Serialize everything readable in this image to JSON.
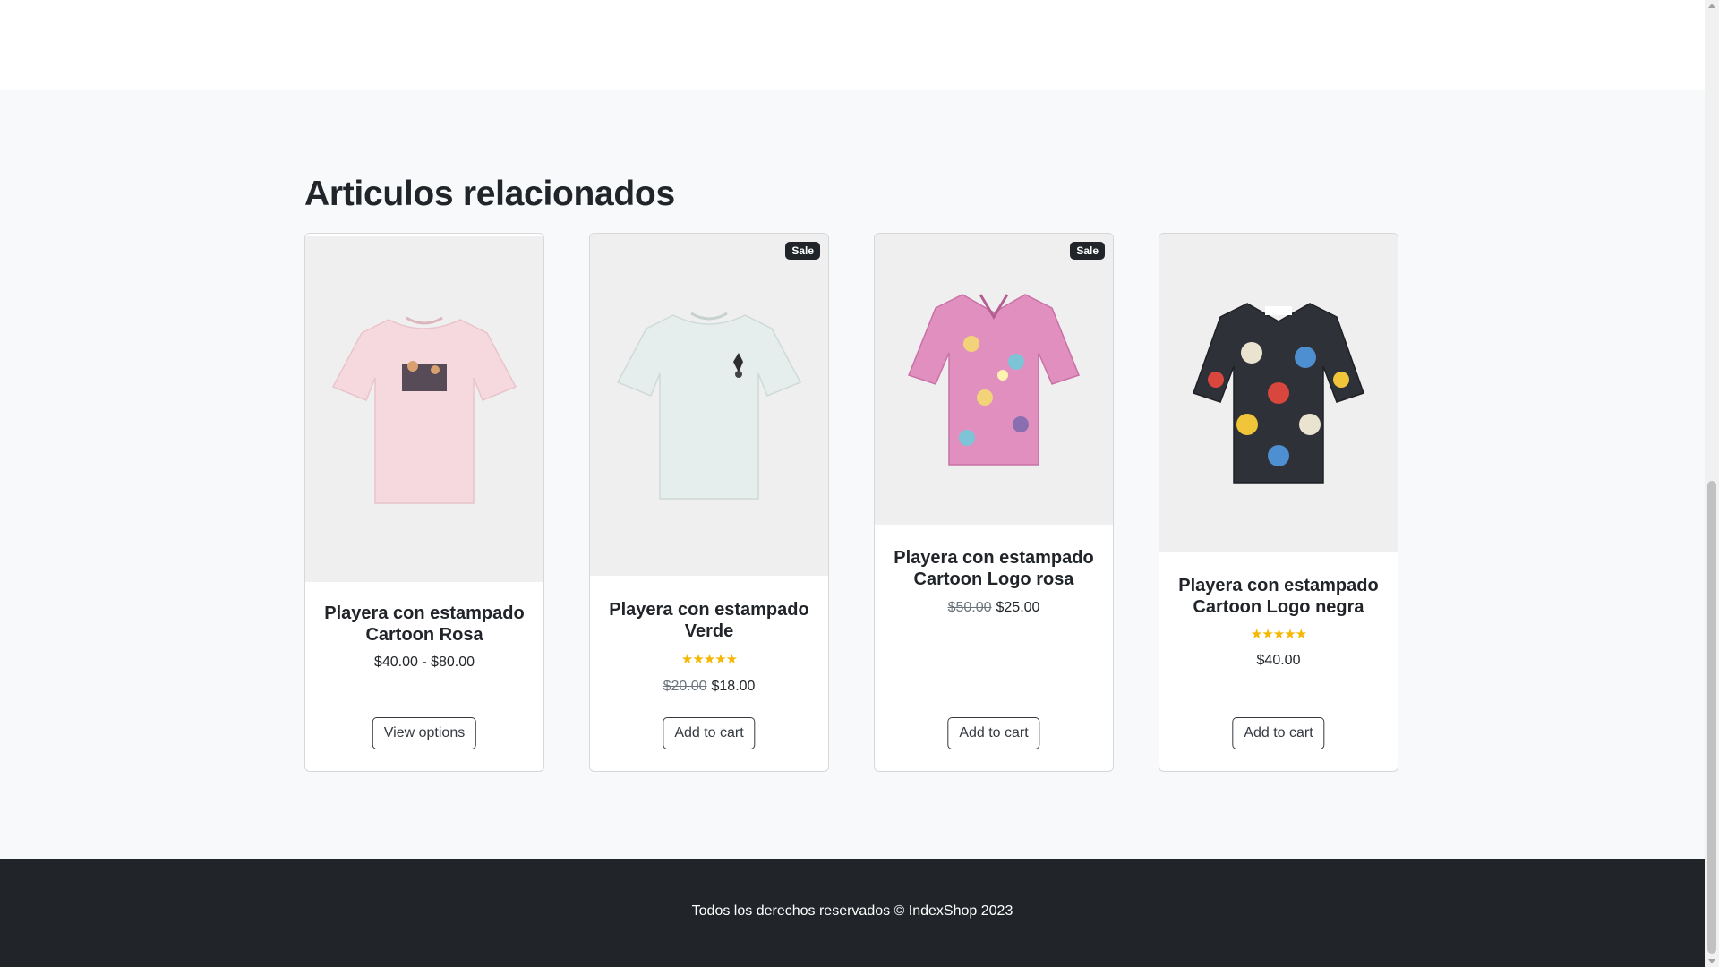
{
  "related": {
    "title": "Articulos relacionados",
    "products": [
      {
        "name": "Playera con estampado Cartoon Rosa",
        "badge": "",
        "rating": 0,
        "price_old": "",
        "price": "$40.00 - $80.00",
        "button": "View options",
        "image_color": "#f6d9de",
        "image_icon": "pink-tshirt-image"
      },
      {
        "name": "Playera con estampado Verde",
        "badge": "Sale",
        "rating": 5,
        "stars": "★★★★★",
        "price_old": "$20.00",
        "price": "$18.00",
        "button": "Add to cart",
        "image_color": "#e5eeec",
        "image_icon": "mint-tshirt-image"
      },
      {
        "name": "Playera con estampado Cartoon Logo rosa",
        "badge": "Sale",
        "rating": 0,
        "price_old": "$50.00",
        "price": "$25.00",
        "button": "Add to cart",
        "image_color": "#e08fbf",
        "image_icon": "pink-print-shirt-image"
      },
      {
        "name": "Playera con estampado Cartoon Logo negra",
        "badge": "",
        "rating": 5,
        "stars": "★★★★★",
        "price_old": "",
        "price": "$40.00",
        "button": "Add to cart",
        "image_color": "#2f3138",
        "image_icon": "black-print-shirt-image"
      }
    ]
  },
  "footer": {
    "text": "Todos los derechos reservados © IndexShop 2023"
  },
  "colors": {
    "section_bg": "#f8f9fa",
    "footer_bg": "#212529",
    "badge_bg": "#212529",
    "star": "#f5b700"
  }
}
